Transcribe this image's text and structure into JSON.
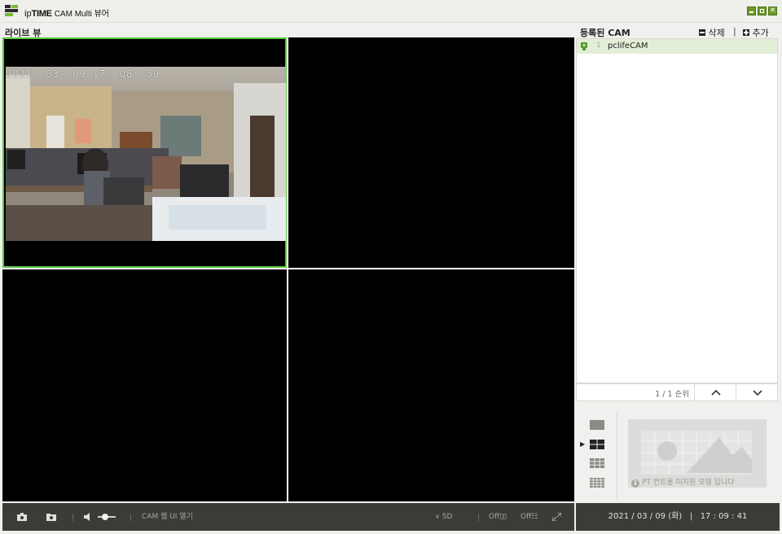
{
  "app": {
    "title_brand_ip": "ip",
    "title_brand_time": "TIME",
    "title_rest": "CAM Multi 뷰어"
  },
  "live_view": {
    "title": "라이브 뷰",
    "osd_timestamp": "2021- 03- 09  17: 08: 39"
  },
  "registered": {
    "title": "등록된 CAM",
    "delete_label": "삭제",
    "add_label": "추가",
    "separator": "|",
    "cameras": [
      {
        "index": "1",
        "name": "pclifeCAM"
      }
    ],
    "pager_text": "1 / 1 순위"
  },
  "toolbar": {
    "web_ui_label": "CAM 웹 UI 열기",
    "quality_label": "SD",
    "off_label_1": "Off",
    "off_label_2": "Off"
  },
  "status": {
    "date": "2021 / 03 / 09 (화)",
    "separator": "|",
    "time": "17 : 09 : 41"
  },
  "ptz": {
    "message": "PT 컨트롤 미지원 모델 입니다"
  },
  "colors": {
    "accent_green": "#5cc846",
    "toolbar_bg": "#3c3b36",
    "selected_row": "#e2efd6"
  }
}
